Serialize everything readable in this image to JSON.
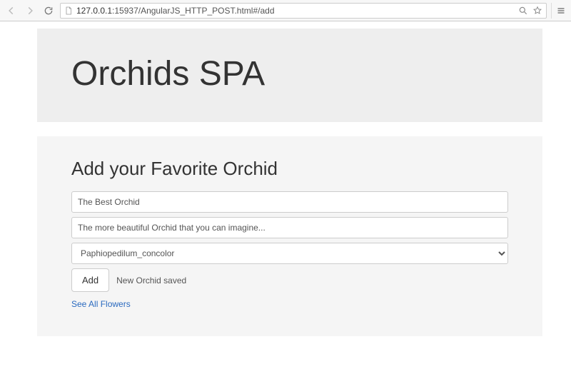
{
  "browser": {
    "url_host": "127.0.0.1",
    "url_port_path": ":15937/AngularJS_HTTP_POST.html#/add"
  },
  "header": {
    "title": "Orchids SPA"
  },
  "form": {
    "heading": "Add your Favorite Orchid",
    "name_value": "The Best Orchid",
    "description_value": "The more beautiful Orchid that you can imagine...",
    "species_selected": "Paphiopedilum_concolor",
    "add_button_label": "Add",
    "status_message": "New Orchid saved",
    "see_all_label": "See All Flowers"
  }
}
